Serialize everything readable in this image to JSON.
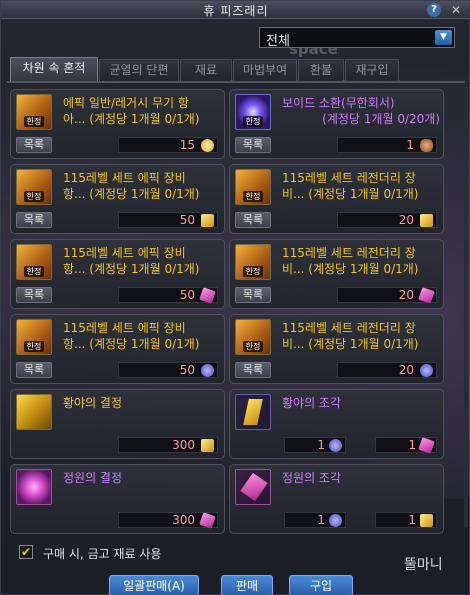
{
  "window": {
    "title": "휴 피즈래리",
    "help": "?",
    "close": "✕"
  },
  "filter": {
    "selected": "전체"
  },
  "background_text": "space",
  "tabs": [
    {
      "label": "차원 속 혼적",
      "active": true
    },
    {
      "label": "균열의 단편"
    },
    {
      "label": "재료"
    },
    {
      "label": "마법부여"
    },
    {
      "label": "환불"
    },
    {
      "label": "재구입"
    }
  ],
  "items": [
    {
      "name1": "에픽 일반/레거시 무기 항",
      "name2": "아... (계정당 1개월 0/1개)",
      "price": "15",
      "currency": "orb-icon",
      "tag": "한정",
      "icon": "chest",
      "list": "목록"
    },
    {
      "name1": "보이드 소환(무한회서)",
      "name2": "(계정당 1개월 0/20개)",
      "price": "1",
      "currency": "bag-icon",
      "tag": "한정",
      "icon": "void",
      "list": "목록",
      "purple": true
    },
    {
      "name1": "115레벨 세트 에픽 장비",
      "name2": "항... (계정당 1개월 0/1개)",
      "price": "50",
      "currency": "yellow-shard-icon",
      "tag": "한정",
      "icon": "chest",
      "list": "목록"
    },
    {
      "name1": "115레벨 세트 레전더리 장",
      "name2": "비... (계정당 1개월 0/1개)",
      "price": "20",
      "currency": "yellow-shard-icon",
      "tag": "한정",
      "icon": "chest",
      "list": "목록"
    },
    {
      "name1": "115레벨 세트 에픽 장비",
      "name2": "항... (계정당 1개월 0/1개)",
      "price": "50",
      "currency": "pink-shard-icon",
      "tag": "한정",
      "icon": "chest",
      "list": "목록"
    },
    {
      "name1": "115레벨 세트 레전더리 장",
      "name2": "비... (계정당 1개월 0/1개)",
      "price": "20",
      "currency": "pink-shard-icon",
      "tag": "한정",
      "icon": "chest",
      "list": "목록"
    },
    {
      "name1": "115레벨 세트 에픽 장비",
      "name2": "항... (계정당 1개월 0/1개)",
      "price": "50",
      "currency": "blue-orb-icon",
      "tag": "한정",
      "icon": "chest",
      "list": "목록"
    },
    {
      "name1": "115레벨 세트 레전더리 장",
      "name2": "비... (계정당 1개월 0/1개)",
      "price": "20",
      "currency": "blue-orb-icon",
      "tag": "한정",
      "icon": "chest",
      "list": "목록"
    },
    {
      "name1": "황야의 결정",
      "price": "300",
      "currency": "yellow-shard-icon",
      "icon": "crystal"
    },
    {
      "name1": "황야의 조각",
      "priceA": "1",
      "currencyA": "blue-orb-icon",
      "priceB": "1",
      "currencyB": "pink-shard-icon",
      "icon": "shard"
    },
    {
      "name1": "정원의 결정",
      "price": "300",
      "currency": "pink-shard-icon",
      "icon": "gem"
    },
    {
      "name1": "정원의 조각",
      "priceA": "1",
      "currencyA": "blue-orb-icon",
      "priceB": "1",
      "currencyB": "yellow-shard-icon",
      "icon": "pshard"
    }
  ],
  "footer": {
    "checkbox_label": "구매 시, 금고 재료 사용",
    "checked": true,
    "bulk_sell": "일괄판매(A)",
    "sell": "판매",
    "buy": "구입",
    "watermark": "뚤마니"
  }
}
